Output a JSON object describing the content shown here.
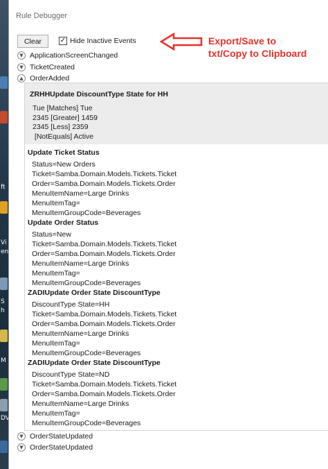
{
  "window": {
    "title": "Rule Debugger"
  },
  "toolbar": {
    "clear_label": "Clear",
    "hide_inactive_label": "Hide Inactive Events",
    "hide_inactive_checked": "✓"
  },
  "annotation": {
    "line1": "Export/Save to",
    "line2": "txt/Copy to Clipboard",
    "color": "#e8302a"
  },
  "events_top": [
    {
      "label": "ApplicationScreenChanged",
      "icon": "chevron-down-icon"
    },
    {
      "label": "TicketCreated",
      "icon": "chevron-down-icon"
    },
    {
      "label": "OrderAdded",
      "icon": "chevron-up-icon"
    }
  ],
  "expanded_event": {
    "header": {
      "title": "ZRHHUpdate DiscountType State for HH",
      "lines": [
        "Tue [Matches] Tue",
        "2345 [Greater] 1459",
        "2345 [Less] 2359",
        " [NotEquals] Active"
      ]
    },
    "actions": [
      {
        "title": "Update Ticket Status",
        "lines": [
          "Status=New Orders",
          "Ticket=Samba.Domain.Models.Tickets.Ticket",
          "Order=Samba.Domain.Models.Tickets.Order",
          "MenuItemName=Large Drinks",
          "MenuItemTag=",
          "MenuItemGroupCode=Beverages"
        ]
      },
      {
        "title": "Update Order Status",
        "lines": [
          "Status=New",
          "Ticket=Samba.Domain.Models.Tickets.Ticket",
          "Order=Samba.Domain.Models.Tickets.Order",
          "MenuItemName=Large Drinks",
          "MenuItemTag=",
          "MenuItemGroupCode=Beverages"
        ]
      },
      {
        "title": "ZADIUpdate Order State DiscountType",
        "lines": [
          "DiscountType State=HH",
          "Ticket=Samba.Domain.Models.Tickets.Ticket",
          "Order=Samba.Domain.Models.Tickets.Order",
          "MenuItemName=Large Drinks",
          "MenuItemTag=",
          "MenuItemGroupCode=Beverages"
        ]
      },
      {
        "title": "ZADIUpdate Order State DiscountType",
        "lines": [
          "DiscountType State=ND",
          "Ticket=Samba.Domain.Models.Tickets.Ticket",
          "Order=Samba.Domain.Models.Tickets.Order",
          "MenuItemName=Large Drinks",
          "MenuItemTag=",
          "MenuItemGroupCode=Beverages"
        ]
      }
    ]
  },
  "events_bottom": [
    {
      "label": "OrderStateUpdated",
      "icon": "chevron-down-icon"
    },
    {
      "label": "OrderStateUpdated",
      "icon": "chevron-down-icon"
    }
  ],
  "desktop_labels": [
    "ft",
    "Vi",
    "en",
    "S",
    "h",
    "M",
    "DV"
  ]
}
